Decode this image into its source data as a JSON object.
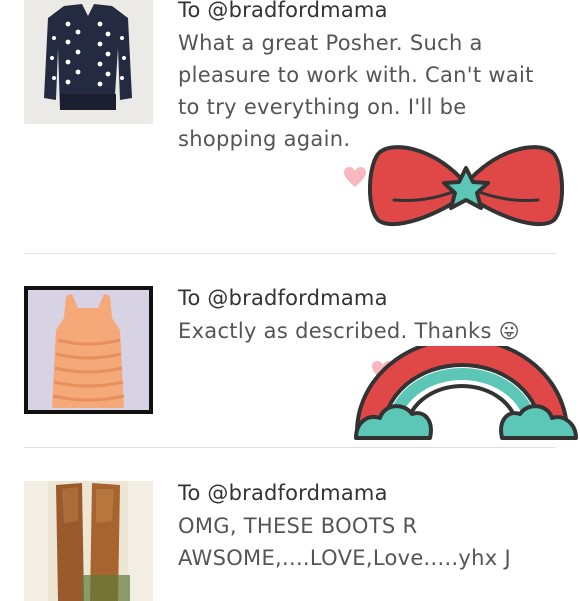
{
  "reviews": [
    {
      "to": "To @bradfordmama",
      "lines": [
        "What a great Posher. Such a",
        "pleasure to work with. Can't wait",
        "to try everything on. I'll be",
        "shopping again."
      ],
      "thumb": "polka-dot-cardigan",
      "heart_icon": "heart-icon"
    },
    {
      "to": "To @bradfordmama",
      "lines": [
        "Exactly as described. Thanks"
      ],
      "emoji": "😛",
      "thumb": "peach-ruffle-tank",
      "heart_icon": "heart-icon"
    },
    {
      "to": "To @bradfordmama",
      "lines": [
        "OMG, THESE BOOTS R",
        "AWSOME,....LOVE,Love.....yhx J"
      ],
      "thumb": "brown-leather-boots"
    }
  ],
  "stickers": [
    "bow-sticker",
    "rainbow-sticker"
  ],
  "colors": {
    "heart": "#f7b8c0",
    "bow_red": "#e04848",
    "teal": "#5cc7b7",
    "outline": "#333333",
    "divider": "#e2e2e2"
  }
}
